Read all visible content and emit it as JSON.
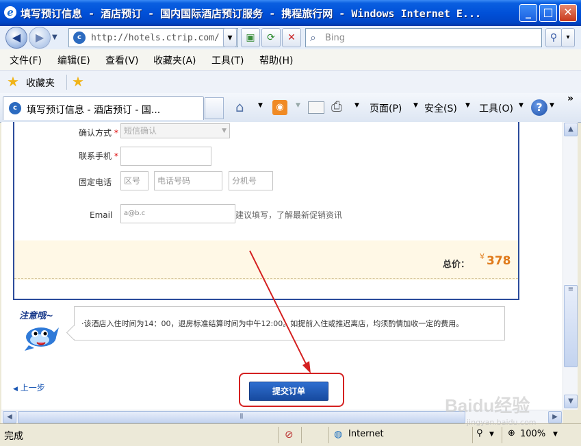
{
  "window": {
    "title": "填写预订信息 - 酒店预订 - 国内国际酒店预订服务 - 携程旅行网 - Windows Internet E...",
    "minimize": "_",
    "maximize": "□",
    "close": "✕"
  },
  "addressbar": {
    "url": "http://hotels.ctrip.com/",
    "search_placeholder": "Bing"
  },
  "menu": {
    "items": [
      "文件(F)",
      "编辑(E)",
      "查看(V)",
      "收藏夹(A)",
      "工具(T)",
      "帮助(H)"
    ]
  },
  "favorites": {
    "label": "收藏夹"
  },
  "tabs": {
    "active_label": "填写预订信息 - 酒店预订 - 国..."
  },
  "commandbar": {
    "page": "页面(P)",
    "safety": "安全(S)",
    "tools": "工具(O)",
    "more": "»"
  },
  "form": {
    "confirm_label": "确认方式",
    "confirm_value": "短信确认",
    "mobile_label": "联系手机",
    "required_mark": "*",
    "phone_label": "固定电话",
    "area_code": "区号",
    "phone_number": "电话号码",
    "extension": "分机号",
    "email_label": "Email",
    "email_value": "a@b.c",
    "email_hint": "建议填写，了解最新促销资讯",
    "total_label": "总价：",
    "currency": "¥",
    "total_value": "378"
  },
  "notice": {
    "badge": "注意哦~",
    "text": "·该酒店入住时间为14：00，退房标准结算时间为中午12:00。如提前入住或推迟离店，均须酌情加收一定的费用。"
  },
  "actions": {
    "back": "上一步",
    "submit": "提交订单"
  },
  "statusbar": {
    "status": "完成",
    "zone": "Internet",
    "zoom": "100%"
  },
  "watermark": {
    "text": "Baidu经验",
    "url": "jingyan.baidu.com"
  }
}
